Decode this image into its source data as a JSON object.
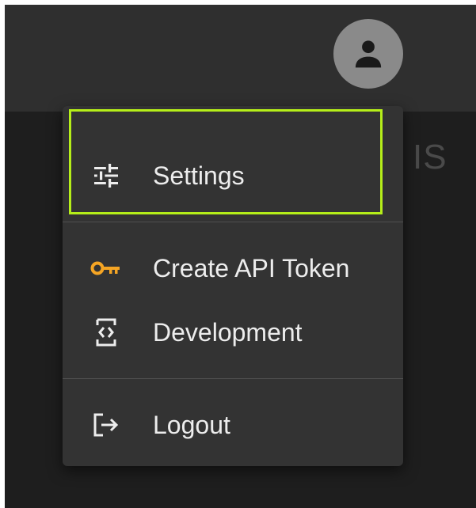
{
  "header": {
    "avatar_icon": "account-circle-icon",
    "avatar_bg": "#8a8a8a"
  },
  "background": {
    "partial_text": "IS"
  },
  "menu": {
    "items": [
      {
        "label": "Settings",
        "icon": "tune-sliders-icon",
        "icon_color": "#ededed",
        "focused": true
      },
      {
        "label": "Create API Token",
        "icon": "key-icon",
        "icon_color": "#f5a524"
      },
      {
        "label": "Development",
        "icon": "code-document-icon",
        "icon_color": "#ededed"
      },
      {
        "label": "Logout",
        "icon": "logout-icon",
        "icon_color": "#ededed"
      }
    ],
    "focus_color": "#b5ee19",
    "bg_color": "#333333"
  }
}
